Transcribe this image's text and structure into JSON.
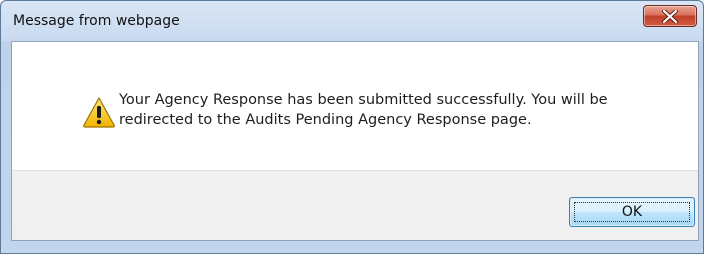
{
  "dialog": {
    "title": "Message from webpage",
    "close_icon": "close-icon",
    "icon": "warning-icon",
    "message": "Your Agency Response has been submitted successfully.  You will be\nredirected to the Audits Pending Agency Response page.",
    "ok_label": "OK"
  },
  "colors": {
    "close_button": "#c1402a",
    "ok_button_border": "#3c7fb1",
    "warning_fill": "#f5c400"
  }
}
